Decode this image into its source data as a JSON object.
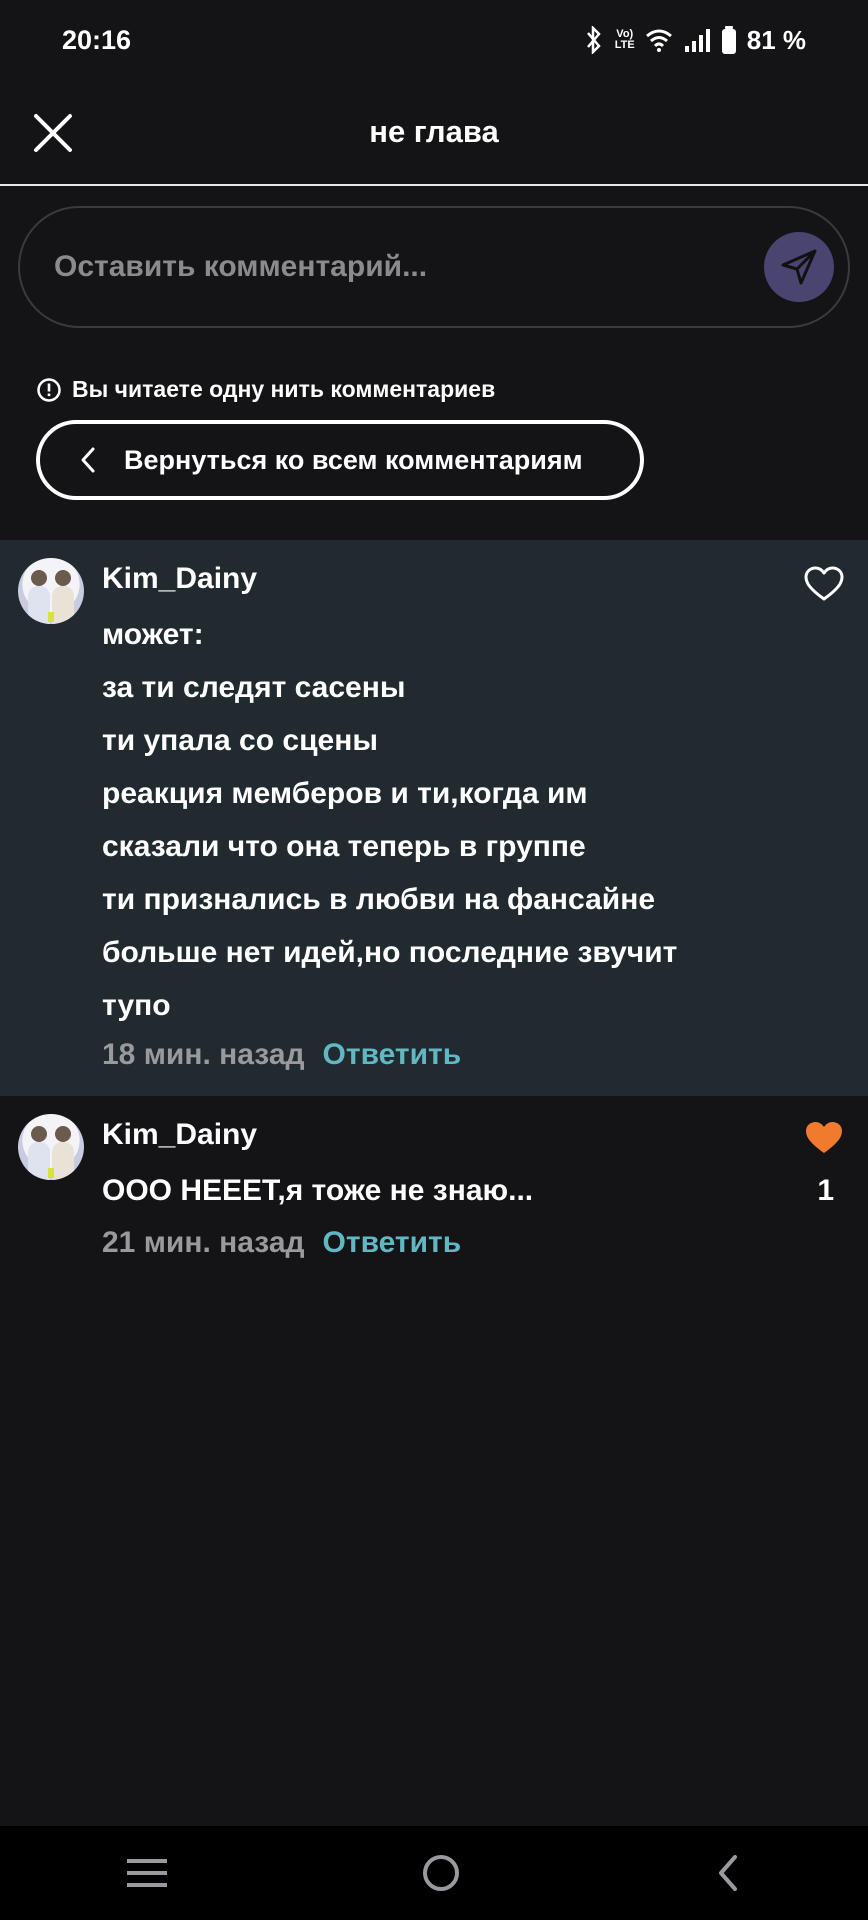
{
  "status_bar": {
    "time": "20:16",
    "lte_top": "Vo)",
    "lte_bottom": "LTE",
    "battery": "81 %"
  },
  "header": {
    "title": "не глава"
  },
  "comment_input": {
    "placeholder": "Оставить комментарий..."
  },
  "thread": {
    "info": "Вы читаете одну нить комментариев",
    "back_label": "Вернуться ко всем комментариям"
  },
  "comments": [
    {
      "username": "Kim_Dainy",
      "text": "может:\nза ти следят сасены\nти упала со сцены\nреакция мемберов и ти,когда им\nсказали что она теперь в группе\nти признались в любви на фансайне\nбольше нет идей,но последние звучит\nтупо",
      "time": "18 мин. назад",
      "reply": "Ответить",
      "liked": false
    },
    {
      "username": "Kim_Dainy",
      "text": "ООО НЕЕЕТ,я тоже не знаю...",
      "time": "21 мин. назад",
      "reply": "Ответить",
      "liked": true,
      "likes": "1"
    }
  ],
  "colors": {
    "background": "#141416",
    "highlight": "#212a2e",
    "reply_link": "#62b7c4",
    "like_active": "#f07a2e",
    "send_button": "#4a4470"
  },
  "icons": [
    "close-icon",
    "send-icon",
    "info-icon",
    "chevron-left-icon",
    "heart-outline-icon",
    "heart-filled-icon",
    "menu-icon",
    "home-icon",
    "back-icon"
  ]
}
